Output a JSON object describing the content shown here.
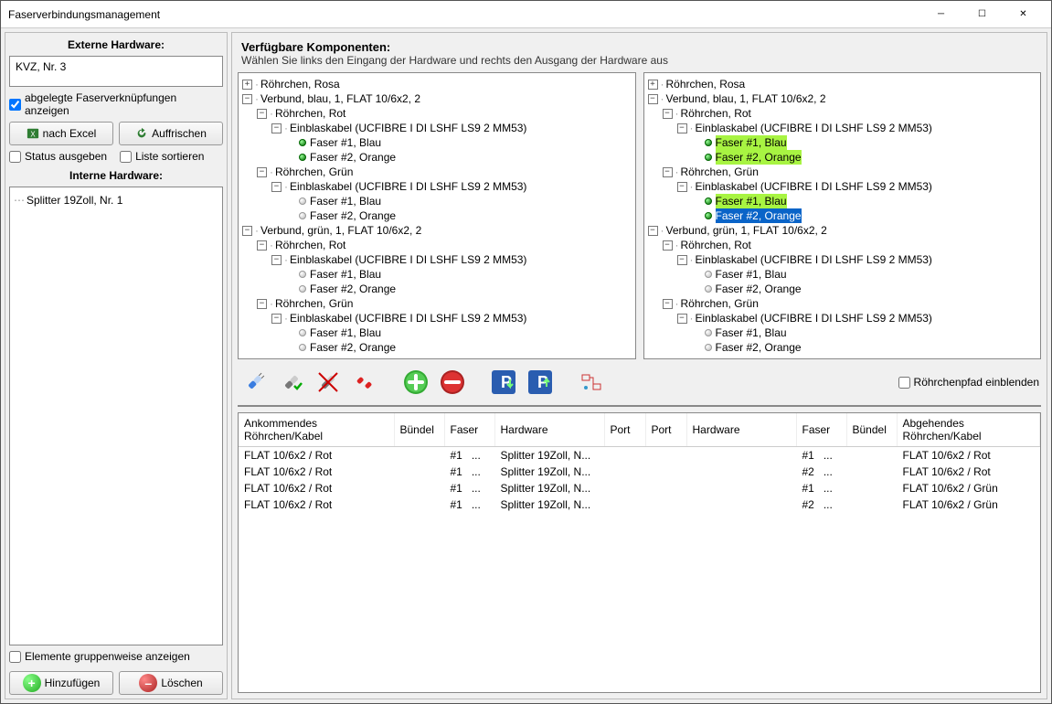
{
  "window": {
    "title": "Faserverbindungsmanagement"
  },
  "left": {
    "ext_label": "Externe Hardware:",
    "ext_value": "KVZ, Nr. 3",
    "chk_abgelegte": "abgelegte Faserverknüpfungen anzeigen",
    "btn_excel": "nach Excel",
    "btn_refresh": "Auffrischen",
    "chk_status": "Status ausgeben",
    "chk_sort": "Liste sortieren",
    "int_label": "Interne Hardware:",
    "int_tree_item": "Splitter 19Zoll, Nr. 1",
    "chk_group": "Elemente gruppenweise anzeigen",
    "btn_add": "Hinzufügen",
    "btn_del": "Löschen"
  },
  "comp": {
    "title": "Verfügbare Komponenten:",
    "hint": "Wählen Sie links den Eingang der Hardware und rechts den Ausgang der Hardware aus"
  },
  "tree_labels": {
    "rosa": "Röhrchen, Rosa",
    "verbund_blau": "Verbund, blau, 1, FLAT 10/6x2, 2",
    "rot": "Röhrchen, Rot",
    "gruen": "Röhrchen, Grün",
    "kabel": "Einblaskabel (UCFIBRE I DI LSHF LS9 2 MM53)",
    "f1": "Faser #1, Blau",
    "f2": "Faser #2, Orange",
    "verbund_gruen": "Verbund, grün, 1, FLAT 10/6x2, 2"
  },
  "toolbar": {
    "chk_path": "Röhrchenpfad einblenden"
  },
  "table": {
    "cols": {
      "c1": "Ankommendes Röhrchen/Kabel",
      "c2": "Bündel",
      "c3": "Faser",
      "c4": "Hardware",
      "c5": "Port",
      "c6": "Port",
      "c7": "Hardware",
      "c8": "Faser",
      "c9": "Bündel",
      "c10": "Abgehendes Röhrchen/Kabel"
    },
    "rows": [
      {
        "c1": "FLAT 10/6x2 / Rot",
        "c3": "#1",
        "c3b": "...",
        "c4": "Splitter 19Zoll, N...",
        "c8": "#1",
        "c8b": "...",
        "c10": "FLAT 10/6x2 / Rot"
      },
      {
        "c1": "FLAT 10/6x2 / Rot",
        "c3": "#1",
        "c3b": "...",
        "c4": "Splitter 19Zoll, N...",
        "c8": "#2",
        "c8b": "...",
        "c10": "FLAT 10/6x2 / Rot"
      },
      {
        "c1": "FLAT 10/6x2 / Rot",
        "c3": "#1",
        "c3b": "...",
        "c4": "Splitter 19Zoll, N...",
        "c8": "#1",
        "c8b": "...",
        "c10": "FLAT 10/6x2 / Grün"
      },
      {
        "c1": "FLAT 10/6x2 / Rot",
        "c3": "#1",
        "c3b": "...",
        "c4": "Splitter 19Zoll, N...",
        "c8": "#2",
        "c8b": "...",
        "c10": "FLAT 10/6x2 / Grün"
      }
    ]
  }
}
